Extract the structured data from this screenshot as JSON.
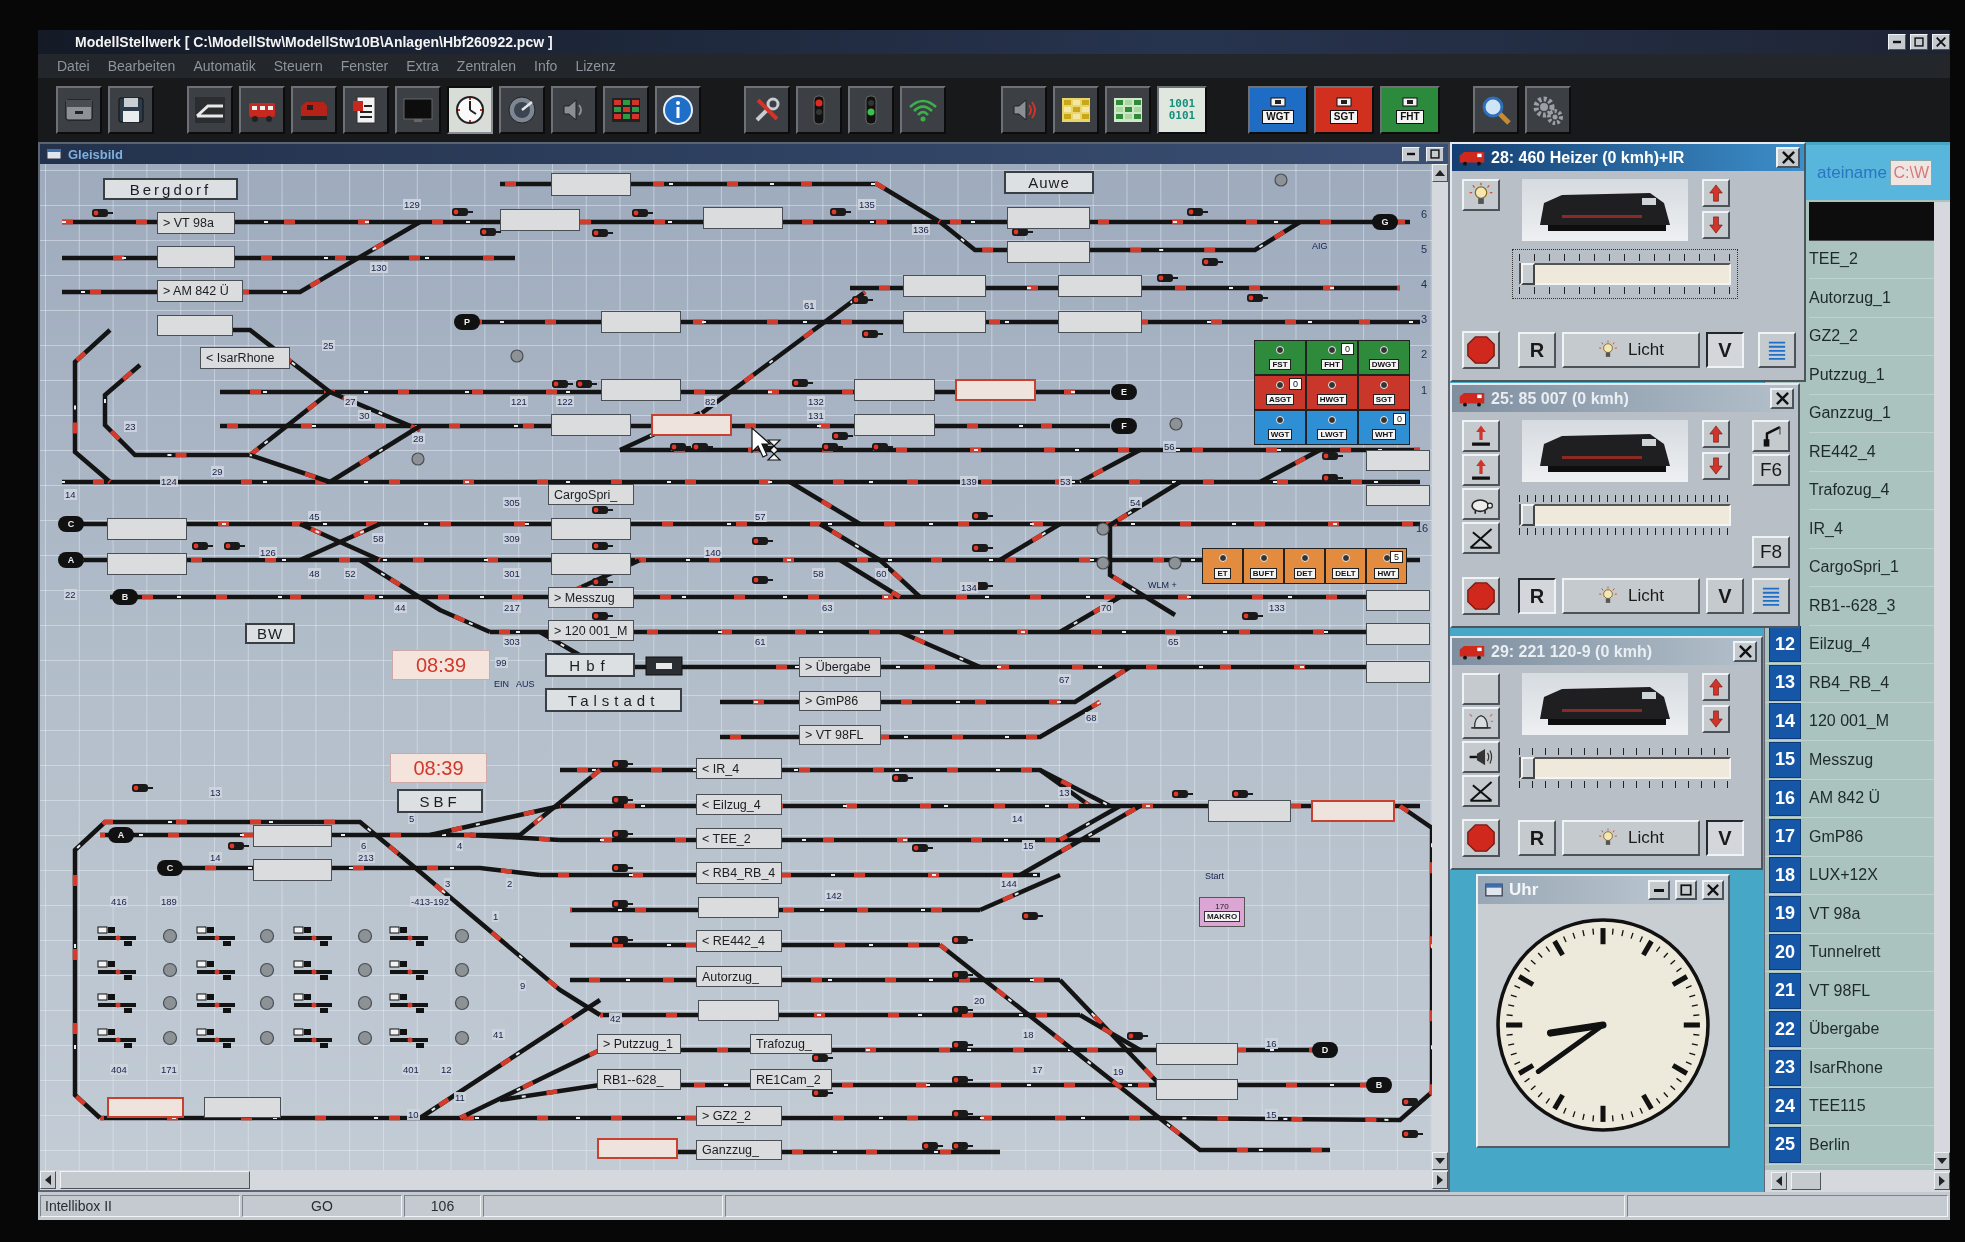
{
  "window": {
    "title": "ModellStellwerk [ C:\\ModellStw\\ModellStw10B\\Anlagen\\Hbf260922.pcw ]"
  },
  "menu": [
    "Datei",
    "Bearbeiten",
    "Automatik",
    "Steuern",
    "Fenster",
    "Extra",
    "Zentralen",
    "Info",
    "Lizenz"
  ],
  "toolbar": {
    "groups": [
      {
        "buttons": [
          {
            "kind": "drawer",
            "pressed": false
          },
          {
            "kind": "floppy",
            "pressed": false
          }
        ]
      },
      {
        "buttons": [
          {
            "kind": "turnout",
            "pressed": false
          },
          {
            "kind": "train",
            "pressed": false
          },
          {
            "kind": "locomotive",
            "pressed": false
          },
          {
            "kind": "document",
            "pressed": false
          },
          {
            "kind": "monitor",
            "pressed": false
          },
          {
            "kind": "clock",
            "pressed": true
          },
          {
            "kind": "dial",
            "pressed": false
          },
          {
            "kind": "speaker",
            "pressed": false
          },
          {
            "kind": "grid",
            "pressed": false
          },
          {
            "kind": "info",
            "pressed": false
          }
        ]
      },
      {
        "buttons": [
          {
            "kind": "tools",
            "pressed": false
          },
          {
            "kind": "signal_stop",
            "pressed": false
          },
          {
            "kind": "signal_go",
            "pressed": false
          },
          {
            "kind": "wireless",
            "pressed": false
          }
        ]
      },
      {
        "buttons": [
          {
            "kind": "sound",
            "pressed": false
          },
          {
            "kind": "occupancy",
            "pressed": false
          },
          {
            "kind": "blocks",
            "pressed": false
          },
          {
            "kind": "bits",
            "label": "1001 0101",
            "pressed": false
          }
        ]
      },
      {
        "buttons": [
          {
            "kind": "key",
            "label": "WGT",
            "color": "#1f6cc4",
            "pressed": false
          },
          {
            "kind": "key",
            "label": "SGT",
            "color": "#d2301f",
            "pressed": false
          },
          {
            "kind": "key",
            "label": "FHT",
            "color": "#2c8a3c",
            "pressed": false
          }
        ]
      },
      {
        "buttons": [
          {
            "kind": "search",
            "pressed": false
          },
          {
            "kind": "settings",
            "pressed": false
          }
        ]
      }
    ]
  },
  "gleisbild": {
    "title": "Gleisbild",
    "stations": [
      "Bergdorf",
      "Auwe",
      "BW",
      "Hbf",
      "Talstadt",
      "SBF"
    ],
    "clocks": [
      "08:39",
      "08:39"
    ],
    "train_boxes": [
      {
        "reserved": false
      },
      {
        "text": "> VT 98a",
        "reserved": false
      },
      {
        "reserved": false
      },
      {
        "reserved": false
      },
      {
        "reserved": false
      },
      {
        "reserved": false
      },
      {
        "reserved": false
      },
      {
        "text": "> AM 842 Ü",
        "reserved": false
      },
      {
        "reserved": false
      },
      {
        "reserved": false
      },
      {
        "reserved": false
      },
      {
        "reserved": false
      },
      {
        "reserved": false
      },
      {
        "reserved": false
      },
      {
        "text": "< IsarRhone",
        "reserved": false
      },
      {
        "reserved": false
      },
      {
        "reserved": false
      },
      {
        "reserved": true
      },
      {
        "reserved": false
      },
      {
        "reserved": true
      },
      {
        "reserved": false
      },
      {
        "reserved": false
      },
      {
        "text": "CargoSpri_",
        "reserved": false
      },
      {
        "reserved": false
      },
      {
        "reserved": false
      },
      {
        "reserved": false
      },
      {
        "reserved": false
      },
      {
        "reserved": false
      },
      {
        "text": "> Messzug",
        "reserved": false
      },
      {
        "reserved": false
      },
      {
        "text": "> 120 001_M",
        "reserved": false
      },
      {
        "reserved": false
      },
      {
        "text": "> Übergabe",
        "reserved": false
      },
      {
        "reserved": false
      },
      {
        "text": "> GmP86",
        "reserved": false
      },
      {
        "text": "> VT 98FL",
        "reserved": false
      },
      {
        "text": "< IR_4",
        "reserved": false
      },
      {
        "text": "< Eilzug_4",
        "reserved": false
      },
      {
        "reserved": false
      },
      {
        "reserved": true
      },
      {
        "reserved": false
      },
      {
        "text": "< TEE_2",
        "reserved": false
      },
      {
        "reserved": false
      },
      {
        "text": "< RB4_RB_4",
        "reserved": false
      },
      {
        "reserved": false
      },
      {
        "text": "< RE442_4",
        "reserved": false
      },
      {
        "text": "Autorzug_",
        "reserved": false
      },
      {
        "reserved": false
      },
      {
        "text": "> Putzzug_1",
        "reserved": false
      },
      {
        "text": "Trafozug_",
        "reserved": false
      },
      {
        "reserved": false
      },
      {
        "text": "RB1--628_",
        "reserved": false
      },
      {
        "text": "RE1Cam_2",
        "reserved": false
      },
      {
        "reserved": false
      },
      {
        "reserved": true
      },
      {
        "reserved": false
      },
      {
        "text": "> GZ2_2",
        "reserved": false
      },
      {
        "reserved": true
      },
      {
        "text": "Ganzzug_",
        "reserved": false
      }
    ],
    "track_numbers": [
      "129",
      "135",
      "136",
      "130",
      "61",
      "25",
      "27",
      "121",
      "122",
      "82",
      "132",
      "30",
      "131",
      "23",
      "28",
      "56",
      "29",
      "124",
      "139",
      "53",
      "14",
      "305",
      "54",
      "45",
      "57",
      "58",
      "309",
      "126",
      "140",
      "48",
      "52",
      "301",
      "58",
      "60",
      "134",
      "22",
      "44",
      "217",
      "63",
      "70",
      "133",
      "303",
      "61",
      "65",
      "99",
      "67",
      "68",
      "13",
      "13",
      "5",
      "14",
      "6",
      "4",
      "15",
      "14",
      "213",
      "3",
      "2",
      "144",
      "142",
      "416",
      "189",
      "-413-192",
      "1",
      "9",
      "20",
      "42",
      "41",
      "18",
      "16",
      "404",
      "171",
      "401",
      "12",
      "17",
      "19",
      "11",
      "10",
      "15"
    ],
    "row_numbers": [
      "6",
      "5",
      "4",
      "3",
      "2",
      "1",
      "16"
    ],
    "track_ends": [
      "G",
      "P",
      "E",
      "F",
      "C",
      "A",
      "B",
      "A",
      "C",
      "D",
      "B"
    ],
    "captions": [
      "AIG",
      "WLM +",
      "EIN",
      "AUS"
    ],
    "control_panel": {
      "rows": [
        {
          "buttons": [
            {
              "label": "FST",
              "color": "#2e8b3c"
            },
            {
              "label": "FHT",
              "color": "#2e8b3c",
              "counter": "0"
            },
            {
              "label": "DWGT",
              "color": "#2e8b3c"
            }
          ]
        },
        {
          "buttons": [
            {
              "label": "ASGT",
              "color": "#c9372a",
              "counter": "0"
            },
            {
              "label": "HWGT",
              "color": "#c9372a"
            },
            {
              "label": "SGT",
              "color": "#c9372a"
            }
          ]
        },
        {
          "buttons": [
            {
              "label": "WGT",
              "color": "#2e8fd4"
            },
            {
              "label": "LWGT",
              "color": "#2e8fd4"
            },
            {
              "label": "WHT",
              "color": "#2e8fd4",
              "counter": "0"
            }
          ]
        },
        {
          "buttons": [
            {
              "label": "ET",
              "color": "#e38b3e"
            },
            {
              "label": "BUFT",
              "color": "#e38b3e"
            },
            {
              "label": "DET",
              "color": "#e38b3e"
            },
            {
              "label": "DELT",
              "color": "#e38b3e"
            },
            {
              "label": "HWT",
              "color": "#e38b3e",
              "counter": "5"
            }
          ]
        }
      ]
    },
    "macro": {
      "caption": "Start",
      "number": "170",
      "label": "MAKRO"
    }
  },
  "loco_windows": [
    {
      "title": "28: 460 Heizer (0 kmh)+IR",
      "active": true,
      "left_buttons": [
        {
          "kind": "light"
        }
      ],
      "speed": {
        "level": 0
      },
      "controls": [
        {
          "kind": "stop"
        },
        {
          "kind": "direction",
          "label": "R",
          "selected": false
        },
        {
          "kind": "light",
          "label": "Licht"
        },
        {
          "kind": "direction",
          "label": "V",
          "selected": true
        },
        {
          "kind": "menu"
        }
      ]
    },
    {
      "title": "25: 85 007 (0 kmh)",
      "active": false,
      "left_buttons": [
        {
          "kind": "uncouple"
        },
        {
          "kind": "uncouple"
        },
        {
          "kind": "slow"
        },
        {
          "kind": "shunt"
        }
      ],
      "right_buttons": [
        {
          "kind": "crane"
        },
        {
          "kind": "function",
          "label": "F6"
        },
        {
          "kind": "function",
          "label": "F8"
        }
      ],
      "speed": {
        "level": 0
      },
      "controls": [
        {
          "kind": "stop"
        },
        {
          "kind": "direction",
          "label": "R",
          "selected": true
        },
        {
          "kind": "light",
          "label": "Licht"
        },
        {
          "kind": "direction",
          "label": "V",
          "selected": false
        },
        {
          "kind": "menu"
        }
      ]
    },
    {
      "title": "29: 221 120-9 (0 kmh)",
      "active": false,
      "left_buttons": [
        {
          "kind": "blank"
        },
        {
          "kind": "bell"
        },
        {
          "kind": "horn"
        },
        {
          "kind": "shunt"
        }
      ],
      "speed": {
        "level": 0
      },
      "controls": [
        {
          "kind": "stop"
        },
        {
          "kind": "direction",
          "label": "R",
          "selected": false
        },
        {
          "kind": "light",
          "label": "Licht"
        },
        {
          "kind": "direction",
          "label": "V",
          "selected": true
        }
      ]
    }
  ],
  "uhr": {
    "title": "Uhr"
  },
  "train_list": {
    "column_header": "ateiname",
    "path": "C:\\W",
    "items": [
      {
        "selected": true
      },
      {
        "name": "TEE_2",
        "selected": false
      },
      {
        "name": "Autorzug_1",
        "selected": false
      },
      {
        "name": "GZ2_2",
        "selected": false
      },
      {
        "name": "Putzzug_1",
        "selected": false
      },
      {
        "name": "Ganzzug_1",
        "selected": false
      },
      {
        "name": "RE442_4",
        "selected": false
      },
      {
        "name": "Trafozug_4",
        "selected": false
      },
      {
        "name": "IR_4",
        "selected": false
      },
      {
        "name": "CargoSpri_1",
        "selected": false
      },
      {
        "name": "RB1--628_3",
        "selected": false
      },
      {
        "number": "12",
        "name": "Eilzug_4",
        "selected": false
      },
      {
        "number": "13",
        "name": "RB4_RB_4",
        "selected": false
      },
      {
        "number": "14",
        "name": "120 001_M",
        "selected": false
      },
      {
        "number": "15",
        "name": "Messzug",
        "selected": false
      },
      {
        "number": "16",
        "name": "AM 842 Ü",
        "selected": false
      },
      {
        "number": "17",
        "name": "GmP86",
        "selected": false
      },
      {
        "number": "18",
        "name": "LUX+12X",
        "selected": false
      },
      {
        "number": "19",
        "name": "VT 98a",
        "selected": false
      },
      {
        "number": "20",
        "name": "Tunnelrett",
        "selected": false
      },
      {
        "number": "21",
        "name": "VT 98FL",
        "selected": false
      },
      {
        "number": "22",
        "name": "Übergabe",
        "selected": false
      },
      {
        "number": "23",
        "name": "IsarRhone",
        "selected": false
      },
      {
        "number": "24",
        "name": "TEE115",
        "selected": false
      },
      {
        "number": "25",
        "name": "Berlin",
        "selected": false
      }
    ]
  },
  "status_bar": [
    "Intellibox II",
    "GO",
    "106"
  ]
}
